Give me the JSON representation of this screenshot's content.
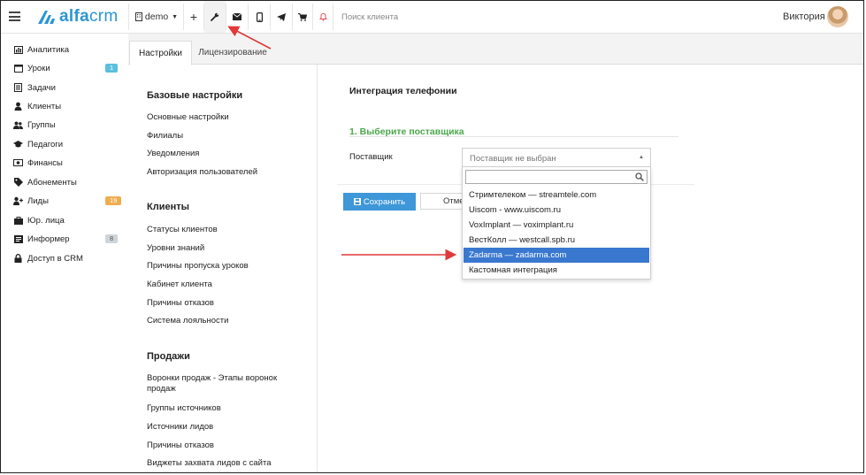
{
  "topbar": {
    "logo_text_bold": "alfa",
    "logo_text": "crm",
    "demo_label": "demo",
    "search_placeholder": "Поиск клиента",
    "user_name": "Виктория"
  },
  "sidebar": {
    "items": [
      {
        "label": "Аналитика",
        "icon": "chart-icon"
      },
      {
        "label": "Уроки",
        "icon": "calendar-icon",
        "badge": "1",
        "badge_color": "#5bc0de"
      },
      {
        "label": "Задачи",
        "icon": "tasks-icon"
      },
      {
        "label": "Клиенты",
        "icon": "user-icon"
      },
      {
        "label": "Группы",
        "icon": "users-icon"
      },
      {
        "label": "Педагоги",
        "icon": "graduation-cap-icon"
      },
      {
        "label": "Финансы",
        "icon": "money-icon"
      },
      {
        "label": "Абонементы",
        "icon": "tag-icon"
      },
      {
        "label": "Лиды",
        "icon": "user-plus-icon",
        "badge": "19",
        "badge_color": "#f0ad4e"
      },
      {
        "label": "Юр. лица",
        "icon": "briefcase-icon"
      },
      {
        "label": "Информер",
        "icon": "newspaper-icon",
        "badge": "8",
        "badge_color": "#cfd4d8"
      },
      {
        "label": "Доступ в CRM",
        "icon": "lock-icon"
      }
    ]
  },
  "tabs": [
    {
      "label": "Настройки",
      "active": true
    },
    {
      "label": "Лицензирование",
      "active": false
    }
  ],
  "settings": {
    "sections": [
      {
        "title": "Базовые настройки",
        "links": [
          "Основные настройки",
          "Филиалы",
          "Уведомления",
          "Авторизация пользователей"
        ]
      },
      {
        "title": "Клиенты",
        "links": [
          "Статусы клиентов",
          "Уровни знаний",
          "Причины пропуска уроков",
          "Кабинет клиента",
          "Причины отказов",
          "Система лояльности"
        ]
      },
      {
        "title": "Продажи",
        "links": [
          "Воронки продаж - Этапы воронок продаж",
          "Группы источников",
          "Источники лидов",
          "Причины отказов",
          "Виджеты захвата лидов с сайта"
        ]
      }
    ]
  },
  "main": {
    "title": "Интеграция телефонии",
    "step_title": "1. Выберите поставщика",
    "field_label": "Поставщик",
    "select_placeholder": "Поставщик не выбран",
    "save_label": "Сохранить",
    "cancel_label": "Отме",
    "options": [
      {
        "label": "Стримтелеком — streamtele.com",
        "highlighted": false
      },
      {
        "label": "Uiscom - www.uiscom.ru",
        "highlighted": false
      },
      {
        "label": "VoxImplant — voximplant.ru",
        "highlighted": false
      },
      {
        "label": "ВестКолл — westcall.spb.ru",
        "highlighted": false
      },
      {
        "label": "Zadarma — zadarma.com",
        "highlighted": true
      },
      {
        "label": "Кастомная интеграция",
        "highlighted": false
      }
    ]
  },
  "colors": {
    "brand": "#2a96d3",
    "accent_green": "#4aa84a",
    "button_blue": "#3d97d8",
    "highlight": "#3a78d0",
    "annotation_red": "#e03a3a"
  }
}
